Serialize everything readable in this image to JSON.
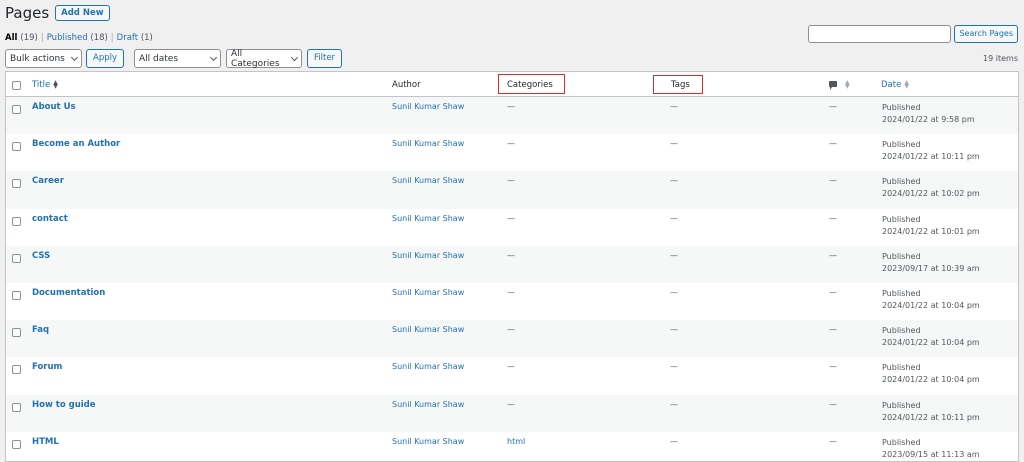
{
  "header": {
    "title": "Pages",
    "add_new": "Add New"
  },
  "views": [
    {
      "label": "All",
      "count": "(19)"
    },
    {
      "label": "Published",
      "count": "(18)"
    },
    {
      "label": "Draft",
      "count": "(1)"
    }
  ],
  "search": {
    "button": "Search Pages",
    "value": ""
  },
  "tablenav": {
    "bulk_actions": "Bulk actions",
    "apply": "Apply",
    "dates": "All dates",
    "categories": "All Categories",
    "filter": "Filter",
    "items_count": "19 items"
  },
  "columns": {
    "title": "Title",
    "author": "Author",
    "categories": "Categories",
    "tags": "Tags",
    "date": "Date"
  },
  "rows": [
    {
      "title": "About Us",
      "author": "Sunil Kumar Shaw",
      "categories": "—",
      "tags": "—",
      "comments": "—",
      "status": "Published",
      "date": "2024/01/22 at 9:58 pm"
    },
    {
      "title": "Become an Author",
      "author": "Sunil Kumar Shaw",
      "categories": "—",
      "tags": "—",
      "comments": "—",
      "status": "Published",
      "date": "2024/01/22 at 10:11 pm"
    },
    {
      "title": "Career",
      "author": "Sunil Kumar Shaw",
      "categories": "—",
      "tags": "—",
      "comments": "—",
      "status": "Published",
      "date": "2024/01/22 at 10:02 pm"
    },
    {
      "title": "contact",
      "author": "Sunil Kumar Shaw",
      "categories": "—",
      "tags": "—",
      "comments": "—",
      "status": "Published",
      "date": "2024/01/22 at 10:01 pm"
    },
    {
      "title": "CSS",
      "author": "Sunil Kumar Shaw",
      "categories": "—",
      "tags": "—",
      "comments": "—",
      "status": "Published",
      "date": "2023/09/17 at 10:39 am"
    },
    {
      "title": "Documentation",
      "author": "Sunil Kumar Shaw",
      "categories": "—",
      "tags": "—",
      "comments": "—",
      "status": "Published",
      "date": "2024/01/22 at 10:04 pm"
    },
    {
      "title": "Faq",
      "author": "Sunil Kumar Shaw",
      "categories": "—",
      "tags": "—",
      "comments": "—",
      "status": "Published",
      "date": "2024/01/22 at 10:04 pm"
    },
    {
      "title": "Forum",
      "author": "Sunil Kumar Shaw",
      "categories": "—",
      "tags": "—",
      "comments": "—",
      "status": "Published",
      "date": "2024/01/22 at 10:04 pm"
    },
    {
      "title": "How to guide",
      "author": "Sunil Kumar Shaw",
      "categories": "—",
      "tags": "—",
      "comments": "—",
      "status": "Published",
      "date": "2024/01/22 at 10:11 pm"
    },
    {
      "title": "HTML",
      "author": "Sunil Kumar Shaw",
      "categories": "html",
      "tags": "—",
      "comments": "—",
      "status": "Published",
      "date": "2023/09/15 at 11:13 am"
    }
  ],
  "colors": {
    "link": "#2271b1",
    "highlight": "#d32f2f"
  }
}
